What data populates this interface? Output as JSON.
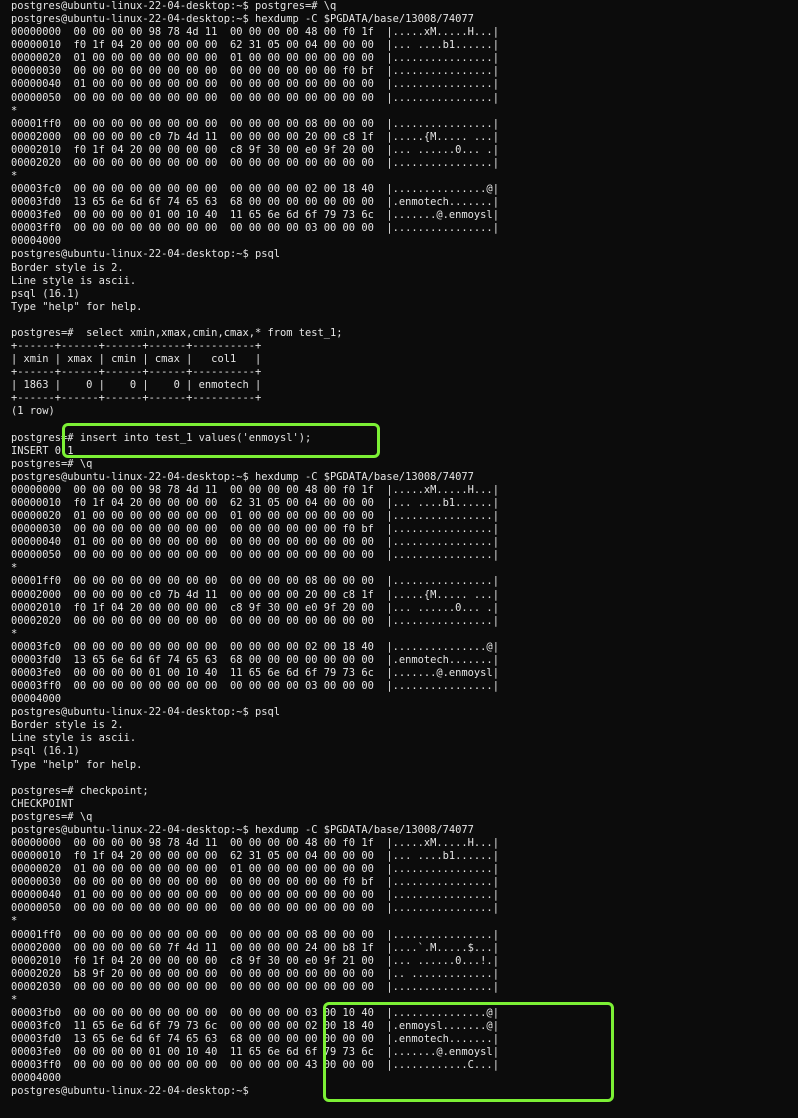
{
  "terminal": {
    "lines": [
      "postgres@ubuntu-linux-22-04-desktop:~$ postgres=# \\q",
      "postgres@ubuntu-linux-22-04-desktop:~$ hexdump -C $PGDATA/base/13008/74077",
      "00000000  00 00 00 00 98 78 4d 11  00 00 00 00 48 00 f0 1f  |.....xM.....H...|",
      "00000010  f0 1f 04 20 00 00 00 00  62 31 05 00 04 00 00 00  |... ....b1......|",
      "00000020  01 00 00 00 00 00 00 00  01 00 00 00 00 00 00 00  |................|",
      "00000030  00 00 00 00 00 00 00 00  00 00 00 00 00 00 f0 bf  |................|",
      "00000040  01 00 00 00 00 00 00 00  00 00 00 00 00 00 00 00  |................|",
      "00000050  00 00 00 00 00 00 00 00  00 00 00 00 00 00 00 00  |................|",
      "*",
      "00001ff0  00 00 00 00 00 00 00 00  00 00 00 00 08 00 00 00  |................|",
      "00002000  00 00 00 00 c0 7b 4d 11  00 00 00 00 20 00 c8 1f  |.....{M..... ...|",
      "00002010  f0 1f 04 20 00 00 00 00  c8 9f 30 00 e0 9f 20 00  |... ......0... .|",
      "00002020  00 00 00 00 00 00 00 00  00 00 00 00 00 00 00 00  |................|",
      "*",
      "00003fc0  00 00 00 00 00 00 00 00  00 00 00 00 02 00 18 40  |...............@|",
      "00003fd0  13 65 6e 6d 6f 74 65 63  68 00 00 00 00 00 00 00  |.enmotech.......|",
      "00003fe0  00 00 00 00 01 00 10 40  11 65 6e 6d 6f 79 73 6c  |.......@.enmoysl|",
      "00003ff0  00 00 00 00 00 00 00 00  00 00 00 00 03 00 00 00  |................|",
      "00004000",
      "postgres@ubuntu-linux-22-04-desktop:~$ psql",
      "Border style is 2.",
      "Line style is ascii.",
      "psql (16.1)",
      "Type \"help\" for help.",
      "",
      "postgres=#  select xmin,xmax,cmin,cmax,* from test_1;",
      "+------+------+------+------+----------+",
      "| xmin | xmax | cmin | cmax |   col1   |",
      "+------+------+------+------+----------+",
      "| 1863 |    0 |    0 |    0 | enmotech |",
      "+------+------+------+------+----------+",
      "(1 row)",
      "",
      "postgres=# insert into test_1 values('enmoysl');",
      "INSERT 0 1",
      "postgres=# \\q",
      "postgres@ubuntu-linux-22-04-desktop:~$ hexdump -C $PGDATA/base/13008/74077",
      "00000000  00 00 00 00 98 78 4d 11  00 00 00 00 48 00 f0 1f  |.....xM.....H...|",
      "00000010  f0 1f 04 20 00 00 00 00  62 31 05 00 04 00 00 00  |... ....b1......|",
      "00000020  01 00 00 00 00 00 00 00  01 00 00 00 00 00 00 00  |................|",
      "00000030  00 00 00 00 00 00 00 00  00 00 00 00 00 00 f0 bf  |................|",
      "00000040  01 00 00 00 00 00 00 00  00 00 00 00 00 00 00 00  |................|",
      "00000050  00 00 00 00 00 00 00 00  00 00 00 00 00 00 00 00  |................|",
      "*",
      "00001ff0  00 00 00 00 00 00 00 00  00 00 00 00 08 00 00 00  |................|",
      "00002000  00 00 00 00 c0 7b 4d 11  00 00 00 00 20 00 c8 1f  |.....{M..... ...|",
      "00002010  f0 1f 04 20 00 00 00 00  c8 9f 30 00 e0 9f 20 00  |... ......0... .|",
      "00002020  00 00 00 00 00 00 00 00  00 00 00 00 00 00 00 00  |................|",
      "*",
      "00003fc0  00 00 00 00 00 00 00 00  00 00 00 00 02 00 18 40  |...............@|",
      "00003fd0  13 65 6e 6d 6f 74 65 63  68 00 00 00 00 00 00 00  |.enmotech.......|",
      "00003fe0  00 00 00 00 01 00 10 40  11 65 6e 6d 6f 79 73 6c  |.......@.enmoysl|",
      "00003ff0  00 00 00 00 00 00 00 00  00 00 00 00 03 00 00 00  |................|",
      "00004000",
      "postgres@ubuntu-linux-22-04-desktop:~$ psql",
      "Border style is 2.",
      "Line style is ascii.",
      "psql (16.1)",
      "Type \"help\" for help.",
      "",
      "postgres=# checkpoint;",
      "CHECKPOINT",
      "postgres=# \\q",
      "postgres@ubuntu-linux-22-04-desktop:~$ hexdump -C $PGDATA/base/13008/74077",
      "00000000  00 00 00 00 98 78 4d 11  00 00 00 00 48 00 f0 1f  |.....xM.....H...|",
      "00000010  f0 1f 04 20 00 00 00 00  62 31 05 00 04 00 00 00  |... ....b1......|",
      "00000020  01 00 00 00 00 00 00 00  01 00 00 00 00 00 00 00  |................|",
      "00000030  00 00 00 00 00 00 00 00  00 00 00 00 00 00 f0 bf  |................|",
      "00000040  01 00 00 00 00 00 00 00  00 00 00 00 00 00 00 00  |................|",
      "00000050  00 00 00 00 00 00 00 00  00 00 00 00 00 00 00 00  |................|",
      "*",
      "00001ff0  00 00 00 00 00 00 00 00  00 00 00 00 08 00 00 00  |................|",
      "00002000  00 00 00 00 60 7f 4d 11  00 00 00 00 24 00 b8 1f  |....`.M.....$...|",
      "00002010  f0 1f 04 20 00 00 00 00  c8 9f 30 00 e0 9f 21 00  |... ......0...!.|",
      "00002020  b8 9f 20 00 00 00 00 00  00 00 00 00 00 00 00 00  |.. .............|",
      "00002030  00 00 00 00 00 00 00 00  00 00 00 00 00 00 00 00  |................|",
      "*",
      "00003fb0  00 00 00 00 00 00 00 00  00 00 00 00 03 00 10 40  |...............@|",
      "00003fc0  11 65 6e 6d 6f 79 73 6c  00 00 00 00 02 00 18 40  |.enmoysl.......@|",
      "00003fd0  13 65 6e 6d 6f 74 65 63  68 00 00 00 00 00 00 00  |.enmotech.......|",
      "00003fe0  00 00 00 00 01 00 10 40  11 65 6e 6d 6f 79 73 6c  |.......@.enmoysl|",
      "00003ff0  00 00 00 00 00 00 00 00  00 00 00 00 43 00 00 00  |............C...|",
      "00004000",
      "postgres@ubuntu-linux-22-04-desktop:~$ "
    ]
  },
  "highlight_color": "#7cf035",
  "text_color": "#e6e6e6",
  "background_color": "#0c0c0c"
}
